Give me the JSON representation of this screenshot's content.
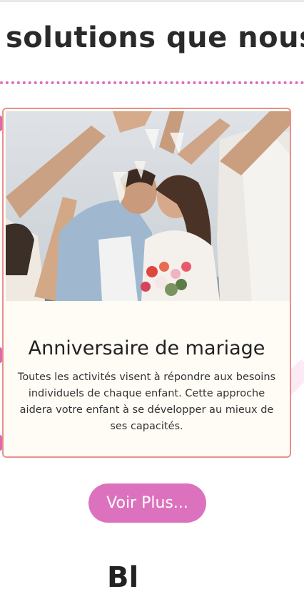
{
  "section": {
    "title": "solutions que nous"
  },
  "card": {
    "image_alt": "Couple s'embrassant entouré d'amis levant des verres de champagne",
    "title": "Anniversaire de mariage",
    "description": "Toutes les activités visent à répondre aux besoins individuels de chaque enfant. Cette approche aidera votre enfant à se développer au mieux de ses capacités."
  },
  "cta": {
    "label": "Voir Plus..."
  },
  "next_section": {
    "title_partial": "Bl"
  },
  "colors": {
    "accent_pink": "#dc72bd",
    "card_border": "#e8908c",
    "card_bg": "#fffbf5",
    "divider_dots": "#d96fb8"
  }
}
